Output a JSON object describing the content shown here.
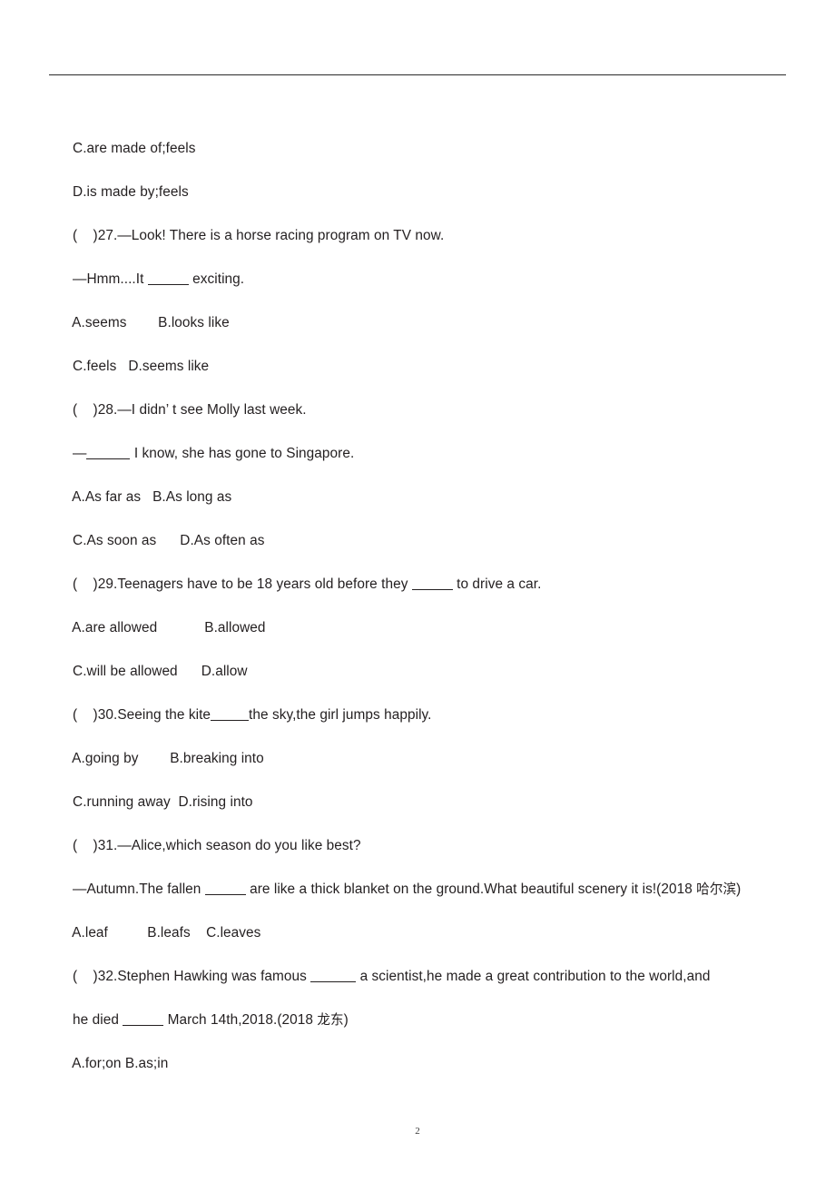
{
  "document": {
    "page_number": "2",
    "header_rule": true,
    "lines": [
      {
        "id": "opt-26-c",
        "text": "C.are made of;feels"
      },
      {
        "id": "opt-26-d",
        "text": "D.is made by;feels"
      },
      {
        "id": "q27-stem",
        "text": "(    )27.—Look! There is a horse racing program on TV now."
      },
      {
        "id": "q27-stem-2-a",
        "text": "—Hmm....It "
      },
      {
        "id": "q27-stem-2-b",
        "text": " exciting."
      },
      {
        "id": "opt-27-ab",
        "text": "A.seems        B.looks like"
      },
      {
        "id": "opt-27-cd",
        "text": "C.feels   D.seems like"
      },
      {
        "id": "q28-stem",
        "text": "(    )28.—I didn’ t see Molly last week."
      },
      {
        "id": "q28-stem-2-a",
        "text": "—"
      },
      {
        "id": "q28-stem-2-b",
        "text": " I know, she has gone to Singapore."
      },
      {
        "id": "opt-28-ab",
        "text": "A.As far as   B.As long as"
      },
      {
        "id": "opt-28-cd",
        "text": "C.As soon as      D.As often as"
      },
      {
        "id": "q29-stem-a",
        "text": "(    )29.Teenagers have to be 18 years old before they "
      },
      {
        "id": "q29-stem-b",
        "text": " to drive a car."
      },
      {
        "id": "opt-29-ab",
        "text": "A.are allowed            B.allowed"
      },
      {
        "id": "opt-29-cd",
        "text": "C.will be allowed      D.allow"
      },
      {
        "id": "q30-stem-a",
        "text": "(    )30.Seeing the kite"
      },
      {
        "id": "q30-stem-b",
        "text": "the sky,the girl jumps happily."
      },
      {
        "id": "opt-30-ab",
        "text": "A.going by        B.breaking into"
      },
      {
        "id": "opt-30-cd",
        "text": "C.running away  D.rising into"
      },
      {
        "id": "q31-stem",
        "text": "(    )31.—Alice,which season do you like best?"
      },
      {
        "id": "q31-stem-2-a",
        "text": "—Autumn.The fallen "
      },
      {
        "id": "q31-stem-2-b",
        "text": " are like a thick blanket on the ground.What beautiful scenery it is!(2018 "
      },
      {
        "id": "q31-stem-2-cjk",
        "text": "哈尔滨"
      },
      {
        "id": "q31-stem-2-c",
        "text": ")"
      },
      {
        "id": "opt-31-abc",
        "text": "A.leaf          B.leafs    C.leaves"
      },
      {
        "id": "q32-stem-a",
        "text": "(    )32.Stephen Hawking was famous "
      },
      {
        "id": "q32-stem-b",
        "text": " a scientist,he made a great contribution to the world,and"
      },
      {
        "id": "q32-stem-2-a",
        "text": "he died "
      },
      {
        "id": "q32-stem-2-b",
        "text": " March 14th,2018.(2018 "
      },
      {
        "id": "q32-stem-2-cjk",
        "text": "龙东"
      },
      {
        "id": "q32-stem-2-c",
        "text": ")"
      },
      {
        "id": "opt-32-ab",
        "text": "A.for;on B.as;in"
      }
    ]
  }
}
